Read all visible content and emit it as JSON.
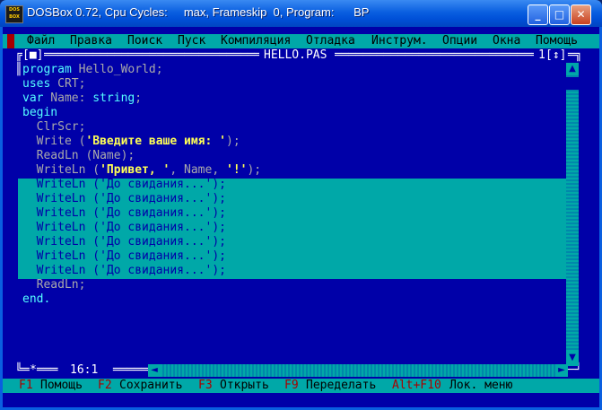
{
  "titlebar": {
    "title": "DOSBox 0.72, Cpu Cycles:     max, Frameskip  0, Program:      BP",
    "app_icon_text": "DOS BOX",
    "minimize_glyph": "_",
    "maximize_glyph": "□",
    "close_glyph": "✕"
  },
  "menu": {
    "items": [
      "Файл",
      "Правка",
      "Поиск",
      "Пуск",
      "Компиляция",
      "Отладка",
      "Инструм.",
      "Опции",
      "Окна",
      "Помощь"
    ]
  },
  "editor": {
    "file_name": "HELLO.PAS",
    "window_number": "1",
    "close_box": "[■]",
    "zoom_box": "[↕]",
    "cursor_position": "16:1",
    "lines": [
      [
        "program",
        " Hello_World;"
      ],
      [
        "uses",
        " CRT;"
      ],
      [
        "var",
        " Name: ",
        "string",
        ";"
      ],
      [
        "begin"
      ],
      [
        "  ClrScr;"
      ],
      [
        "  Write (",
        "'Введите ваше имя: '",
        ");"
      ],
      [
        "  ReadLn (Name);"
      ],
      [
        "  WriteLn (",
        "'Привет, '",
        ", Name, ",
        "'!'",
        ");"
      ],
      [
        "  WriteLn (",
        "'До свидания...'",
        ");"
      ],
      [
        "  WriteLn (",
        "'До свидания...'",
        ");"
      ],
      [
        "  WriteLn (",
        "'До свидания...'",
        ");"
      ],
      [
        "  WriteLn (",
        "'До свидания...'",
        ");"
      ],
      [
        "  WriteLn (",
        "'До свидания...'",
        ");"
      ],
      [
        "  WriteLn (",
        "'До свидания...'",
        ");"
      ],
      [
        "  WriteLn (",
        "'До свидания...'",
        ");"
      ],
      [
        "  ReadLn;"
      ],
      [
        "end."
      ]
    ]
  },
  "statusbar": {
    "items": [
      {
        "key": "F1",
        "label": "Помощь"
      },
      {
        "key": "F2",
        "label": "Сохранить"
      },
      {
        "key": "F3",
        "label": "Открыть"
      },
      {
        "key": "F9",
        "label": "Переделать"
      },
      {
        "key": "Alt+F10",
        "label": "Лок. меню"
      }
    ]
  },
  "colors": {
    "background": "#0000a8",
    "menu": "#00a8a8",
    "selection": "#00a8a8",
    "text": "#ffff55",
    "hotkey": "#a80000"
  }
}
